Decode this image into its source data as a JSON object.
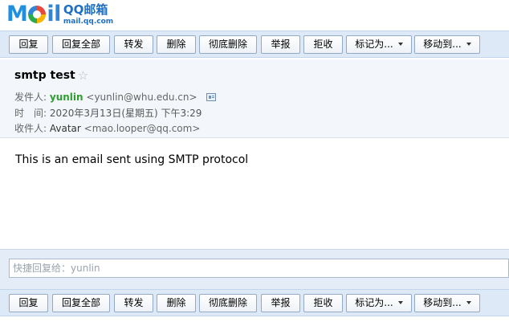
{
  "logo": {
    "wordmark": "Mail",
    "name": "QQ邮箱",
    "domain": "mail.qq.com"
  },
  "toolbar": {
    "buttons": [
      {
        "label": "回复"
      },
      {
        "label": "回复全部"
      },
      {
        "label": "转发"
      },
      {
        "label": "删除"
      },
      {
        "label": "彻底删除"
      },
      {
        "label": "举报"
      },
      {
        "label": "拒收"
      },
      {
        "label": "标记为..."
      },
      {
        "label": "移动到..."
      }
    ]
  },
  "mail": {
    "subject": "smtp test",
    "star_icon": "star-outline-icon",
    "from_label": "发件人:",
    "from_name": "yunlin",
    "from_address": "<yunlin@whu.edu.cn>",
    "contact_icon": "contact-card-icon",
    "time_label": "时　间:",
    "time_value": "2020年3月13日(星期五) 下午3:29",
    "to_label": "收件人:",
    "to_name": "Avatar",
    "to_address": "<mao.looper@qq.com>",
    "body": "This is an email sent using SMTP protocol"
  },
  "quick_reply": {
    "placeholder": "快捷回复给：yunlin"
  },
  "colors": {
    "toolbar_bg": "#dde9f6",
    "sender_green": "#2e9e2e",
    "brand_blue": "#2f86d6"
  }
}
